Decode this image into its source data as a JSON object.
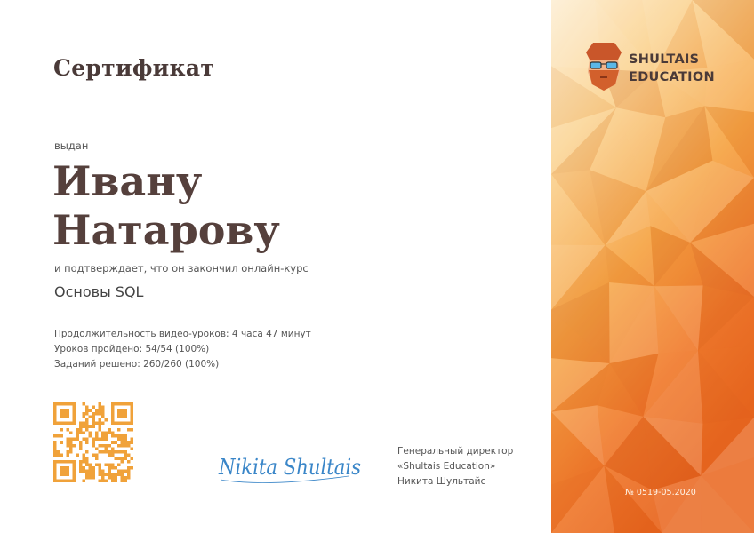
{
  "certificate": {
    "title": "Сертификат",
    "issued_label": "выдан",
    "recipient_line1": "Ивану",
    "recipient_line2": "Натарову",
    "confirm_text": "и подтверждает, что он закончил онлайн-курс",
    "course_name": "Основы SQL",
    "stats": {
      "duration": "Продолжительность видео-уроков: 4 часа 47 минут",
      "lessons": "Уроков пройдено: 54/54 (100%)",
      "tasks": "Заданий решено: 260/260 (100%)"
    },
    "lessons_completed": 54,
    "lessons_total": 54,
    "tasks_completed": 260,
    "tasks_total": 260,
    "signature_text": "Nikita Shultais",
    "director": {
      "role": "Генеральный директор",
      "company": "«Shultais Education»",
      "name": "Никита Шультайс"
    },
    "number": "№ 0519-05.2020"
  },
  "brand": {
    "line1": "SHULTAIS",
    "line2": "EDUCATION",
    "logo_icon": "bearded-man-with-glasses-icon"
  },
  "qr_icon": "qr-code-icon",
  "colors": {
    "title": "#4a3a38",
    "recipient": "#55403c",
    "signature": "#3a86c8",
    "qr": "#f0a23a",
    "panel_light": "#fde8c3",
    "panel_mid": "#f7a94a",
    "panel_dark": "#ec6a24"
  }
}
